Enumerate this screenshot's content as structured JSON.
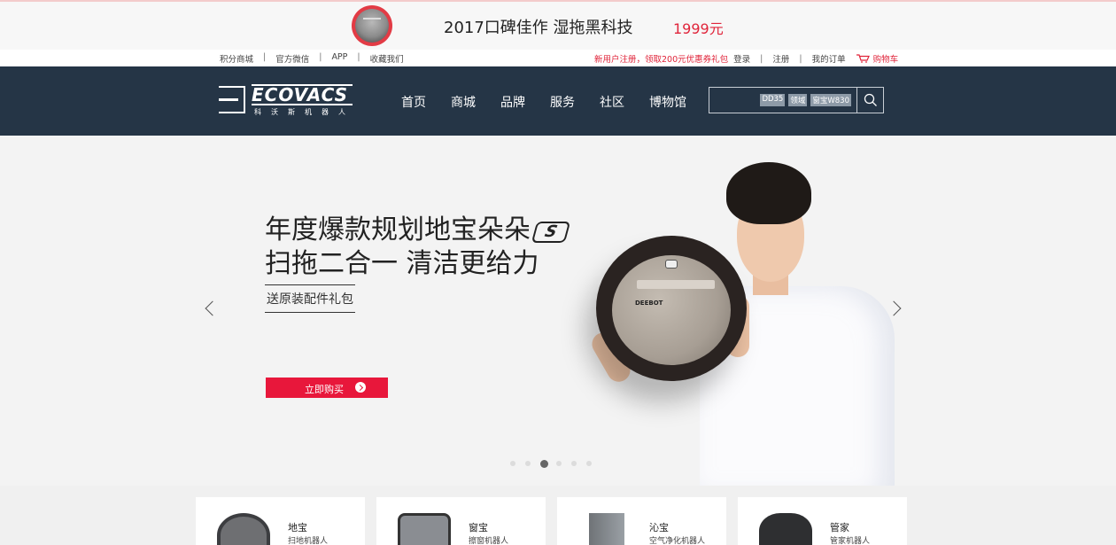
{
  "promo": {
    "title": "2017口碑佳作 湿拖黑科技",
    "price": "1999元"
  },
  "utility": {
    "left_links": [
      "积分商城",
      "官方微信",
      "APP",
      "收藏我们"
    ],
    "register_promo": "新用户注册，领取200元优惠券礼包",
    "login": "登录",
    "register": "注册",
    "orders": "我的订单",
    "cart": "购物车"
  },
  "nav": {
    "logo_word": "ECOVACS",
    "logo_sub": "科沃斯机器人",
    "menu": [
      "首页",
      "商城",
      "品牌",
      "服务",
      "社区",
      "博物馆"
    ],
    "search": {
      "tags": [
        "DD35",
        "领域",
        "窗宝W830"
      ]
    }
  },
  "hero": {
    "headline_line1": "年度爆款规划地宝朵朵",
    "headline_badge": "S",
    "headline_line2": "扫拖二合一 清洁更给力",
    "gift": "送原装配件礼包",
    "buy_label": "立即购买",
    "robot_brand": "DEEBOT",
    "slide_count": 6,
    "active_slide": 3
  },
  "categories": [
    {
      "name": "地宝",
      "desc": "扫地机器人"
    },
    {
      "name": "窗宝",
      "desc": "擦窗机器人"
    },
    {
      "name": "沁宝",
      "desc": "空气净化机器人"
    },
    {
      "name": "管家",
      "desc": "管家机器人"
    }
  ],
  "colors": {
    "accent": "#e8173b",
    "nav_bg": "#253546"
  }
}
